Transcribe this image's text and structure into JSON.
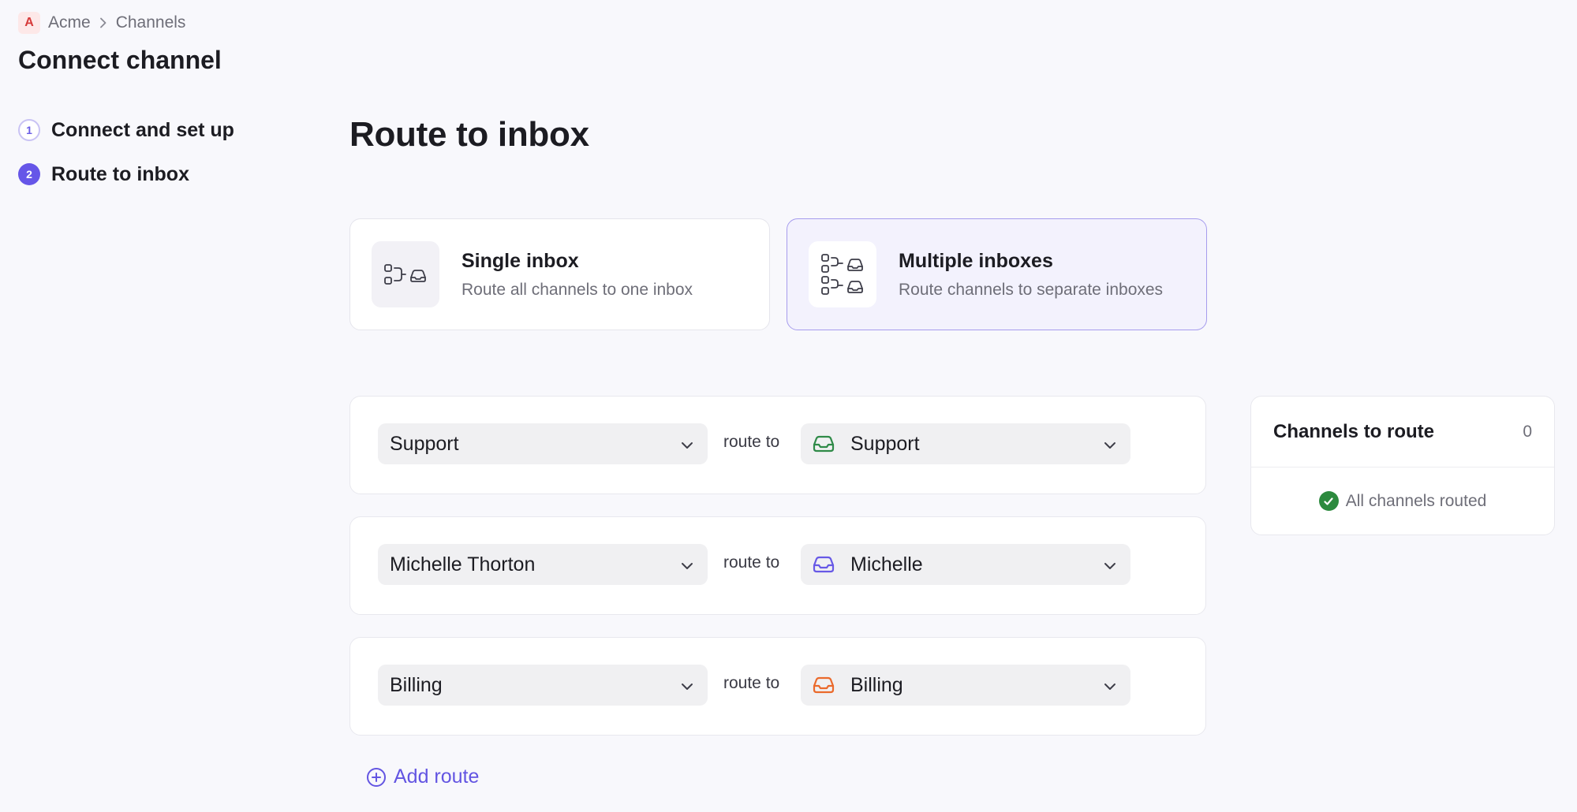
{
  "breadcrumb": {
    "org_badge": "A",
    "org_name": "Acme",
    "section": "Channels"
  },
  "page_title": "Connect channel",
  "steps": [
    {
      "number": "1",
      "label": "Connect and set up",
      "state": "done"
    },
    {
      "number": "2",
      "label": "Route to inbox",
      "state": "active"
    }
  ],
  "main_heading": "Route to inbox",
  "options": [
    {
      "title": "Single inbox",
      "description": "Route all channels to one inbox",
      "selected": false,
      "icon": "single-route-icon"
    },
    {
      "title": "Multiple inboxes",
      "description": "Route channels to separate inboxes",
      "selected": true,
      "icon": "multi-route-icon"
    }
  ],
  "routes": [
    {
      "source": "Support",
      "connector": "route to",
      "target": "Support",
      "target_color": "#2f8a48"
    },
    {
      "source": "Michelle Thorton",
      "connector": "route to",
      "target": "Michelle",
      "target_color": "#6759e6"
    },
    {
      "source": "Billing",
      "connector": "route to",
      "target": "Billing",
      "target_color": "#ea6a2c"
    }
  ],
  "add_route_label": "Add route",
  "side_panel": {
    "title": "Channels to route",
    "count": "0",
    "status": "All channels routed"
  },
  "colors": {
    "accent": "#6656e8",
    "success": "#2c8a3e",
    "org_badge": "#d63a3a"
  }
}
